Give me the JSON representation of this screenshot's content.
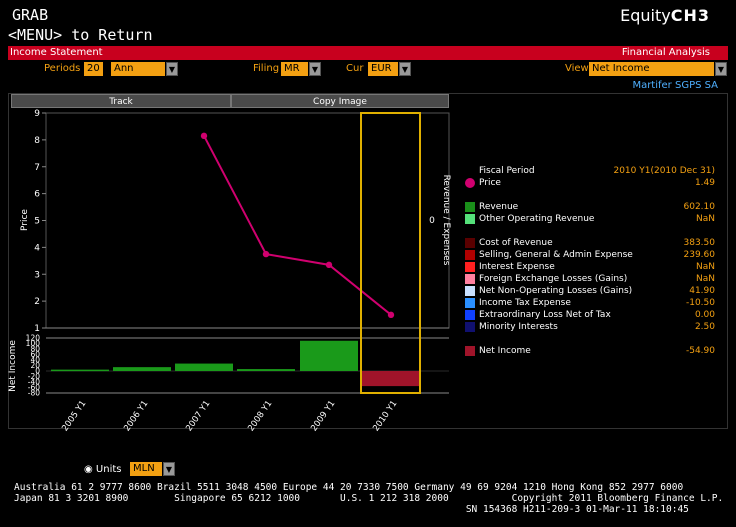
{
  "header": {
    "line1": "GRAB",
    "line2": "<MENU> to Return",
    "brand_prefix": "Equity",
    "brand_code": "CH3"
  },
  "titlebar": {
    "left": "Income Statement",
    "right": "Financial Analysis"
  },
  "controls": {
    "periods_label": "Periods",
    "periods_value": "20",
    "freq_value": "Ann",
    "filing_label": "Filing",
    "filing_value": "MR",
    "cur_label": "Cur",
    "cur_value": "EUR",
    "view_label": "View",
    "view_value": "Net Income"
  },
  "company": "Martifer SGPS SA",
  "buttons": {
    "track": "Track",
    "copy_image": "Copy Image"
  },
  "legend": {
    "fiscal_label": "Fiscal Period",
    "fiscal_value": "2010 Y1(2010 Dec 31)",
    "items": [
      {
        "name": "Price",
        "value": "1.49",
        "color": "#d0006f",
        "shape": "dot"
      },
      {
        "name": "Revenue",
        "value": "602.10",
        "color": "#1a8f1a"
      },
      {
        "name": "Other Operating Revenue",
        "value": "NaN",
        "color": "#55e07a"
      },
      {
        "name": "Cost of Revenue",
        "value": "383.50",
        "color": "#5a0000"
      },
      {
        "name": "Selling, General & Admin Expense",
        "value": "239.60",
        "color": "#b00000"
      },
      {
        "name": "Interest Expense",
        "value": "NaN",
        "color": "#ff2020"
      },
      {
        "name": "Foreign Exchange Losses (Gains)",
        "value": "NaN",
        "color": "#ff7f9f"
      },
      {
        "name": "Net Non-Operating Losses (Gains)",
        "value": "41.90",
        "color": "#c8e0ff"
      },
      {
        "name": "Income Tax Expense",
        "value": "-10.50",
        "color": "#2a8fff"
      },
      {
        "name": "Extraordinary Loss Net of Tax",
        "value": "0.00",
        "color": "#1040ff"
      },
      {
        "name": "Minority Interests",
        "value": "2.50",
        "color": "#101070"
      },
      {
        "name": "Net Income",
        "value": "-54.90",
        "color": "#a0142a"
      }
    ]
  },
  "units": {
    "label": "Units",
    "value": "MLN"
  },
  "footer": {
    "line1": "Australia 61 2 9777 8600 Brazil 5511 3048 4500 Europe 44 20 7330 7500 Germany 49 69 9204 1210 Hong Kong 852 2977 6000",
    "line2": "Japan 81 3 3201 8900        Singapore 65 6212 1000       U.S. 1 212 318 2000           Copyright 2011 Bloomberg Finance L.P.",
    "line3": "                                                                               SN 154368 H211-209-3 01-Mar-11 18:10:45"
  },
  "chart_data": {
    "type": "line+bar",
    "categories": [
      "2005 Y1",
      "2006 Y1",
      "2007 Y1",
      "2008 Y1",
      "2009 Y1",
      "2010 Y1"
    ],
    "price": {
      "ylabel": "Price",
      "ylim": [
        1,
        9
      ],
      "yticks": [
        "1",
        "2",
        "3",
        "4",
        "5",
        "6",
        "7",
        "8",
        "9"
      ],
      "values": [
        null,
        null,
        8.15,
        3.75,
        3.35,
        1.49
      ],
      "color": "#d0006f"
    },
    "revenue_expenses": {
      "ylabel": "Revenue / Expenses",
      "zero_label": "0"
    },
    "net_income": {
      "ylabel": "Net Income",
      "ylim": [
        -80,
        120
      ],
      "yticks": [
        "120",
        "100",
        "80",
        "60",
        "40",
        "20",
        "0",
        "-20",
        "-40",
        "-60",
        "-80"
      ],
      "values": [
        5,
        14,
        27,
        7,
        110,
        -54.9
      ],
      "pos_color": "#1a9a1a",
      "neg_color": "#a0142a"
    },
    "highlight": "2010 Y1",
    "highlight_color": "#e0b000"
  }
}
